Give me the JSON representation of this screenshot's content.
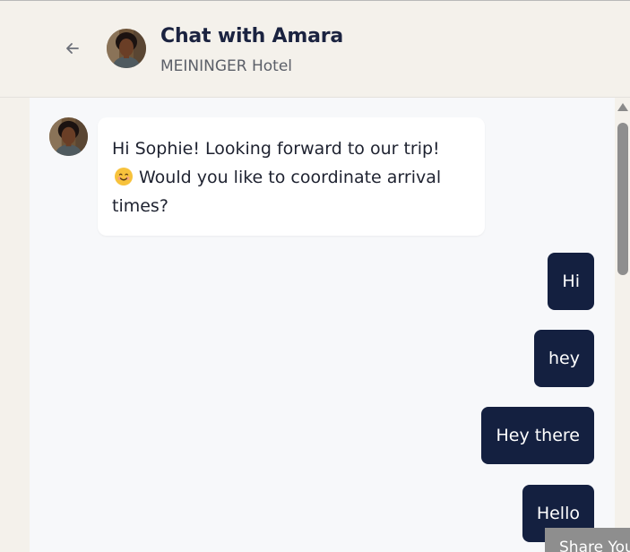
{
  "header": {
    "title": "Chat with Amara",
    "subtitle": "MEININGER Hotel",
    "back_icon": "arrow-left-icon"
  },
  "messages": [
    {
      "direction": "incoming",
      "text_before_emoji": "Hi Sophie! Looking forward to our trip!",
      "emoji": "smiling-face-icon",
      "text_after_emoji": "Would you like to coordinate arrival times?"
    },
    {
      "direction": "outgoing",
      "text": "Hi"
    },
    {
      "direction": "outgoing",
      "text": "hey"
    },
    {
      "direction": "outgoing",
      "text": "Hey there"
    },
    {
      "direction": "outgoing",
      "text": "Hello"
    }
  ],
  "share_button": {
    "label": "Share Your"
  },
  "colors": {
    "header_bg": "#f4f1eb",
    "chat_bg": "#f7f8fa",
    "outgoing_bubble": "#142040",
    "incoming_bubble": "#ffffff",
    "title_text": "#1b2340"
  }
}
